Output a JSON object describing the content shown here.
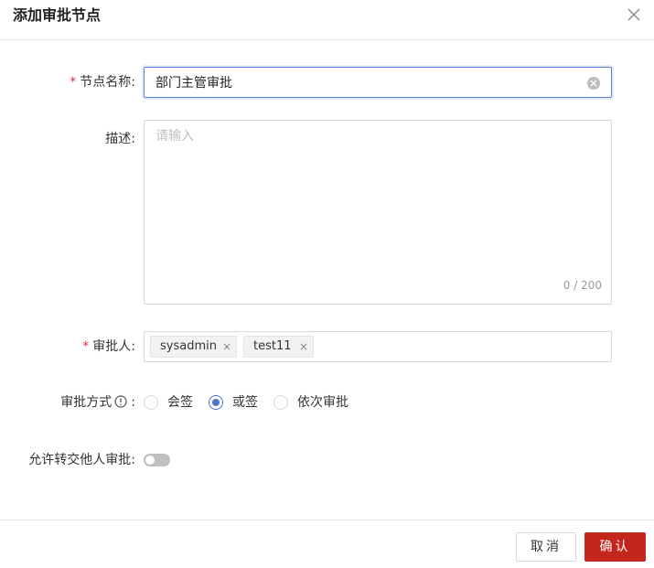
{
  "dialog": {
    "title": "添加审批节点",
    "close_icon": "close-icon"
  },
  "form": {
    "required_mark": "*",
    "name": {
      "label": "节点名称:",
      "value": "部门主管审批"
    },
    "description": {
      "label": "描述:",
      "placeholder": "请输入",
      "counter": "0 / 200"
    },
    "approver": {
      "label": "审批人:",
      "tags": [
        "sysadmin",
        "test11"
      ],
      "remove_glyph": "×"
    },
    "method": {
      "label": "审批方式",
      "colon": ":",
      "info_icon": "info-circle-icon",
      "options": [
        "会签",
        "或签",
        "依次审批"
      ],
      "selected": "或签"
    },
    "transfer": {
      "label": "允许转交他人审批:",
      "enabled": false
    }
  },
  "footer": {
    "cancel_label": "取消",
    "confirm_label": "确认"
  },
  "colors": {
    "primary": "#c4261d",
    "accent_blue": "#4f73d1",
    "required": "#d9363e"
  }
}
